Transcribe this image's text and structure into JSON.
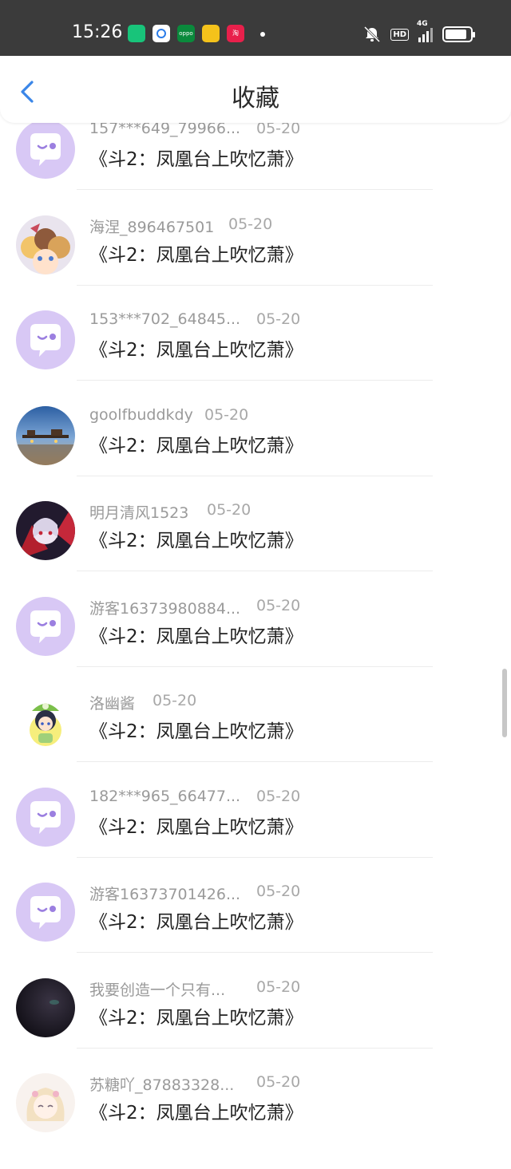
{
  "status_bar": {
    "time": "15:26",
    "hd": "HD",
    "net": "4G",
    "apps": [
      "app-store-icon",
      "browser-icon",
      "oppo-icon",
      "yellow-app-icon",
      "taobao-icon"
    ]
  },
  "header": {
    "title": "收藏",
    "back_icon": "chevron-left-icon",
    "accent": "#3a86e8"
  },
  "items": [
    {
      "user": "157***649_79966...",
      "date": "05-20",
      "text": "《斗2：凤凰台上吹忆萧》",
      "avatar": "default"
    },
    {
      "user": "海涅_896467501",
      "date": "05-20",
      "text": "《斗2：凤凰台上吹忆萧》",
      "avatar": "anime-group"
    },
    {
      "user": "153***702_64845...",
      "date": "05-20",
      "text": "《斗2：凤凰台上吹忆萧》",
      "avatar": "default"
    },
    {
      "user": "goolfbuddkdy",
      "date": "05-20",
      "text": "《斗2：凤凰台上吹忆萧》",
      "avatar": "scenery"
    },
    {
      "user": "明月清风1523",
      "date": "05-20",
      "text": "《斗2：凤凰台上吹忆萧》",
      "avatar": "anime-red"
    },
    {
      "user": "游客16373980884...",
      "date": "05-20",
      "text": "《斗2：凤凰台上吹忆萧》",
      "avatar": "default"
    },
    {
      "user": "洛幽酱",
      "date": "05-20",
      "text": "《斗2：凤凰台上吹忆萧》",
      "avatar": "anime-green"
    },
    {
      "user": "182***965_66477...",
      "date": "05-20",
      "text": "《斗2：凤凰台上吹忆萧》",
      "avatar": "default"
    },
    {
      "user": "游客16373701426...",
      "date": "05-20",
      "text": "《斗2：凤凰台上吹忆萧》",
      "avatar": "default"
    },
    {
      "user": "我要创造一个只有...",
      "date": "05-20",
      "text": "《斗2：凤凰台上吹忆萧》",
      "avatar": "dark"
    },
    {
      "user": "苏糖吖_87883328...",
      "date": "05-20",
      "text": "《斗2：凤凰台上吹忆萧》",
      "avatar": "anime-pale"
    }
  ],
  "colors": {
    "status_bar_bg": "#3b3b3b",
    "default_avatar_bg": "#d8c8f5",
    "default_avatar_accent": "#9b7fe0",
    "username": "#9a9a9a",
    "content": "#222222"
  }
}
